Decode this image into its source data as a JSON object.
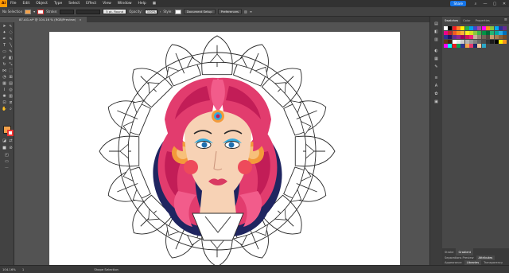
{
  "app": {
    "logo": "Ai"
  },
  "menu": [
    "File",
    "Edit",
    "Object",
    "Type",
    "Select",
    "Effect",
    "View",
    "Window",
    "Help"
  ],
  "share_label": "Share",
  "control": {
    "selection": "No Selection",
    "stroke_label": "Stroke:",
    "stroke_width": "",
    "brush": "5 pt. Round",
    "opacity_label": "Opacity:",
    "opacity_value": "100%",
    "style_label": "Style:",
    "doc_setup": "Document Setup",
    "preferences": "Preferences",
    "fill_color": "#f4a24a"
  },
  "document": {
    "tab_label": "87.Ai1.ai* @ 104.16 % (RGB/Preview)",
    "close": "×"
  },
  "status": {
    "zoom": "104.16%",
    "artboard": "1",
    "mode": "Shape Selection"
  },
  "panel": {
    "top_tabs": [
      "Swatches",
      "Color",
      "Properties"
    ],
    "bottom_rows": [
      [
        "Stroke",
        "Gradient"
      ],
      [
        "Separations Preview",
        "Attributes"
      ],
      [
        "Appearance",
        "Libraries",
        "Transparency"
      ]
    ],
    "swatch_colors": [
      "#ffffff",
      "#000000",
      "#ed1c24",
      "#ff7f27",
      "#fff200",
      "#22b14c",
      "#00a2e8",
      "#3f48cc",
      "#a349a4",
      "#ff00ff",
      "#f7941d",
      "#8dc63f",
      "#00aeef",
      "#2e3192",
      "#662d91",
      "#ec008c",
      "#c1272d",
      "#f15a24",
      "#f7931e",
      "#fbb03b",
      "#fcee21",
      "#d9e021",
      "#8cc63f",
      "#39b54a",
      "#009245",
      "#006837",
      "#22b573",
      "#00a99d",
      "#29abe2",
      "#0071bc",
      "#2e3192",
      "#1b1464",
      "#662d91",
      "#93278f",
      "#9e005d",
      "#d4145a",
      "#ed1e79",
      "#c7b299",
      "#998675",
      "#736357",
      "#534741",
      "#c69c6d",
      "#a67c52",
      "#8c6239",
      "#754c24",
      "#603813",
      "#42210b",
      "#ffffff",
      "#e6e6e6",
      "#cccccc",
      "#b3b3b3",
      "#999999",
      "#808080",
      "#666666",
      "#4d4d4d",
      "#333333",
      "#1a1a1a",
      "#000000",
      "#fff200",
      "#f7941d",
      "#ff00ff",
      "#00ffff",
      "#ed1c24",
      "#00a651",
      "#2e3192",
      "#f4a24a",
      "#e6386e",
      "#1e2b6b",
      "#f9c89b",
      "#2aa8c8"
    ]
  },
  "art": {
    "colors": {
      "outline": "#2a2a2a",
      "hair": "#e23c6e",
      "hair_dark": "#c21d57",
      "hair_light": "#f25c8b",
      "navy": "#1f2560",
      "orange": "#f39a3a",
      "skin": "#f7d2b5",
      "cheek": "#ee4a5b",
      "eye_blue": "#1f6fae",
      "eye_ring": "#33aadd",
      "lip": "#d93a62"
    }
  }
}
